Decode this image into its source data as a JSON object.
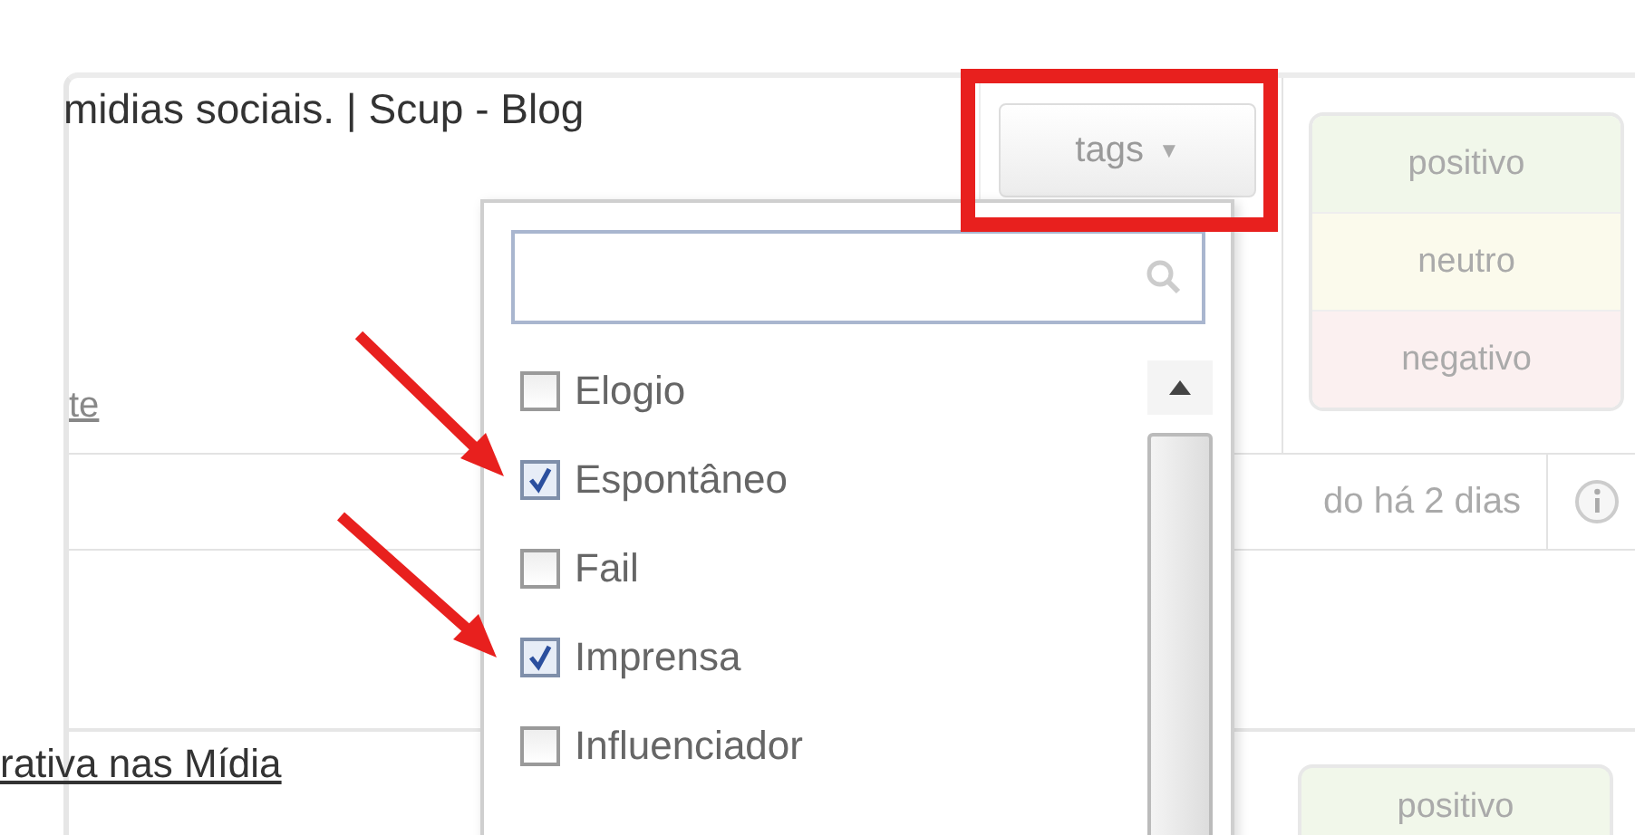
{
  "post": {
    "title": "midias sociais. | Scup - Blog",
    "link": "te"
  },
  "tags_button": {
    "label": "tags",
    "caret": "▼",
    "highlighted": true
  },
  "sentiment": [
    {
      "label": "positivo",
      "color": "#f1f7ea"
    },
    {
      "label": "neutro",
      "color": "#fbfaec"
    },
    {
      "label": "negativo",
      "color": "#fbf0f0"
    }
  ],
  "status": {
    "time": "do há 2 dias"
  },
  "second_post": {
    "title": "rativa nas Mídia",
    "sentiment": {
      "label": "positivo",
      "color": "#f1f7ea"
    }
  },
  "dropdown": {
    "options": [
      {
        "label": "Elogio",
        "checked": false
      },
      {
        "label": "Espontâneo",
        "checked": true
      },
      {
        "label": "Fail",
        "checked": false
      },
      {
        "label": "Imprensa",
        "checked": true
      },
      {
        "label": "Influenciador",
        "checked": false
      }
    ]
  }
}
